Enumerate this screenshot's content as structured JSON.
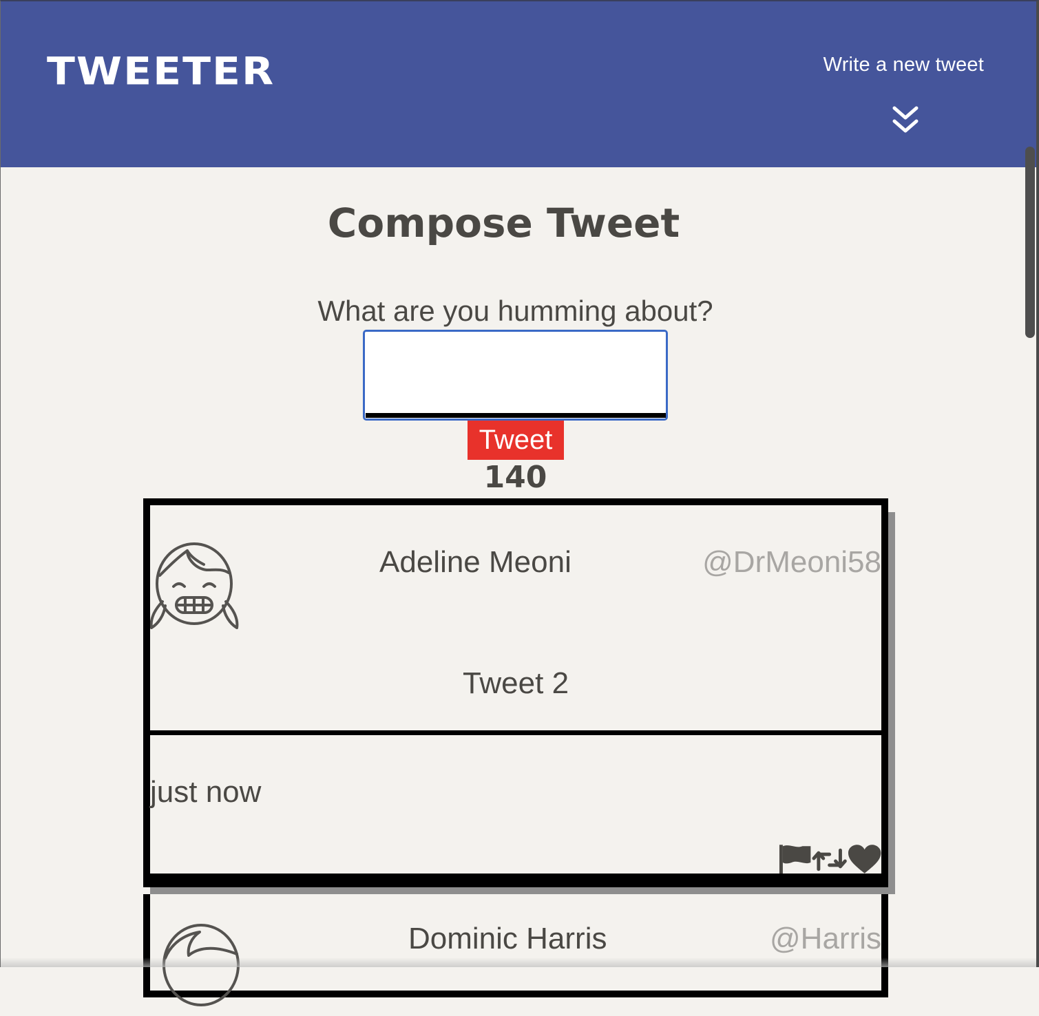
{
  "header": {
    "brand": "TWEETER",
    "compose_toggle_label": "Write a new tweet",
    "compose_toggle_icon": "double-chevron-down-icon",
    "background_color": "#45559b"
  },
  "compose": {
    "title": "Compose Tweet",
    "prompt": "What are you humming about?",
    "textarea_value": "",
    "submit_label": "Tweet",
    "submit_color": "#e8322b",
    "char_counter": "140"
  },
  "tweets": [
    {
      "name": "Adeline Meoni",
      "handle": "@DrMeoni58",
      "avatar_icon": "girl-avatar-icon",
      "content": "Tweet 2",
      "time": "just now",
      "actions": [
        "flag-icon",
        "retweet-icon",
        "heart-icon"
      ]
    },
    {
      "name": "Dominic Harris",
      "handle": "@Harris",
      "avatar_icon": "person-avatar-icon"
    }
  ]
}
